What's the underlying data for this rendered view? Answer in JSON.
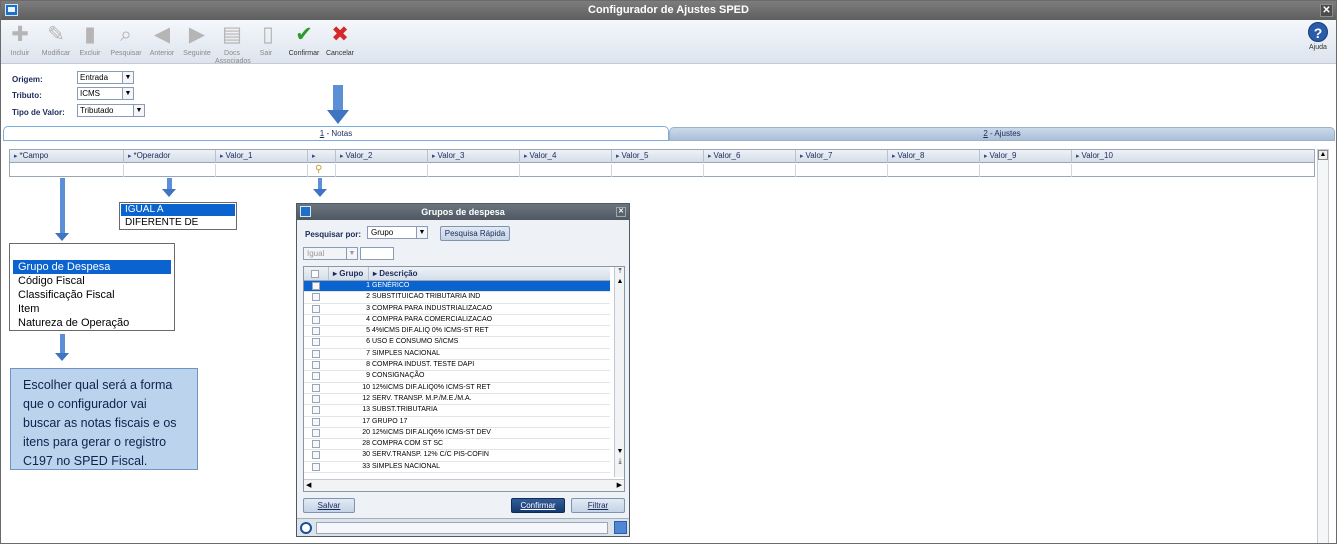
{
  "window": {
    "title": "Configurador de Ajustes SPED"
  },
  "toolbar": [
    {
      "label": "Incluir",
      "icon": "add-icon",
      "enabled": false
    },
    {
      "label": "Modificar",
      "icon": "edit-icon",
      "enabled": false
    },
    {
      "label": "Excluir",
      "icon": "trash-icon",
      "enabled": false
    },
    {
      "label": "Pesquisar",
      "icon": "search-icon",
      "enabled": false
    },
    {
      "label": "Anterior",
      "icon": "arrow-left-icon",
      "enabled": false
    },
    {
      "label": "Seguinte",
      "icon": "arrow-right-icon",
      "enabled": false
    },
    {
      "label": "Docs Associados",
      "icon": "docs-icon",
      "enabled": false
    },
    {
      "label": "Sair",
      "icon": "exit-icon",
      "enabled": false
    },
    {
      "label": "Confirmar",
      "icon": "check-icon",
      "enabled": true
    },
    {
      "label": "Cancelar",
      "icon": "cancel-icon",
      "enabled": true
    }
  ],
  "help": {
    "label": "Ajuda"
  },
  "filters": {
    "origem": {
      "label": "Origem:",
      "value": "Entrada"
    },
    "tributo": {
      "label": "Tributo:",
      "value": "ICMS"
    },
    "tipo_valor": {
      "label": "Tipo de Valor:",
      "value": "Tributado"
    }
  },
  "tabs": [
    {
      "key": "1",
      "label": " - Notas",
      "active": true
    },
    {
      "key": "2",
      "label": " - Ajustes",
      "active": false
    }
  ],
  "grid": {
    "columns": [
      "*Campo",
      "*Operador",
      "Valor_1",
      "",
      "Valor_2",
      "Valor_3",
      "Valor_4",
      "Valor_5",
      "Valor_6",
      "Valor_7",
      "Valor_8",
      "Valor_9",
      "Valor_10"
    ]
  },
  "operador_options": [
    "IGUAL A",
    "DIFERENTE DE"
  ],
  "campo_options": [
    "Grupo de Despesa",
    "Código Fiscal",
    "Classificação Fiscal",
    "Item",
    "Natureza de Operação"
  ],
  "note": {
    "lines": [
      "Escolher qual será a forma",
      "que o configurador vai",
      "buscar as notas fiscais e os",
      "itens para gerar o registro",
      "C197 no SPED Fiscal."
    ]
  },
  "dialog": {
    "title": "Grupos de despesa",
    "search_label": "Pesquisar por:",
    "search_by": "Grupo",
    "quick_search": "Pesquisa Rápida",
    "operator": "Igual",
    "col_grupo": "Grupo",
    "col_descricao": "Descrição",
    "rows": [
      {
        "n": "1",
        "d": "GENÉRICO",
        "selected": true
      },
      {
        "n": "2",
        "d": "SUBSTITUICAO TRIBUTARIA IND"
      },
      {
        "n": "3",
        "d": "COMPRA PARA INDUSTRIALIZACAO"
      },
      {
        "n": "4",
        "d": "COMPRA PARA COMERCIALIZACAO"
      },
      {
        "n": "5",
        "d": "4%ICMS DIF.ALIQ 0% ICMS-ST RET"
      },
      {
        "n": "6",
        "d": "USO E CONSUMO S/ICMS"
      },
      {
        "n": "7",
        "d": "SIMPLES NACIONAL"
      },
      {
        "n": "8",
        "d": "COMPRA INDUST. TESTE DAPI"
      },
      {
        "n": "9",
        "d": "CONSIGNAÇÃO"
      },
      {
        "n": "10",
        "d": "12%ICMS DIF.ALIQ0% ICMS-ST RET"
      },
      {
        "n": "12",
        "d": "SERV. TRANSP. M.P./M.E./M.A."
      },
      {
        "n": "13",
        "d": "SUBST.TRIBUTARIA"
      },
      {
        "n": "17",
        "d": "GRUPO 17"
      },
      {
        "n": "20",
        "d": "12%ICMS DIF.ALIQ6% ICMS-ST DEV"
      },
      {
        "n": "28",
        "d": "COMPRA COM ST SC"
      },
      {
        "n": "30",
        "d": "SERV.TRANSP. 12% C/C PIS-COFIN"
      },
      {
        "n": "33",
        "d": "SIMPLES NACIONAL"
      }
    ],
    "salvar": "Salvar",
    "confirmar": "Confirmar",
    "filtrar": "Filtrar"
  },
  "colors": {
    "selection": "#0a63cf",
    "note_bg": "#bcd3ee",
    "arrow": "#5b8fd6"
  }
}
